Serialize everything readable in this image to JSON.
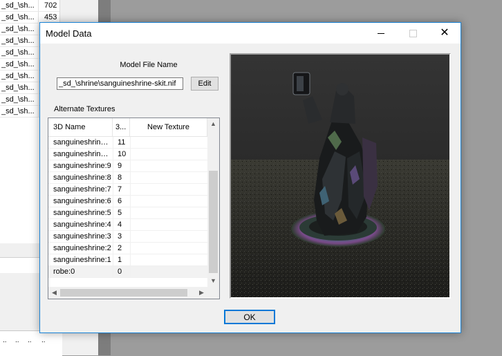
{
  "background_window": {
    "rows": [
      {
        "name": "_sd_\\sh...",
        "value": "702"
      },
      {
        "name": "_sd_\\sh...",
        "value": "453"
      },
      {
        "name": "_sd_\\sh...",
        "value": ""
      },
      {
        "name": "_sd_\\sh...",
        "value": ""
      },
      {
        "name": "_sd_\\sh...",
        "value": ""
      },
      {
        "name": "_sd_\\sh...",
        "value": ""
      },
      {
        "name": "_sd_\\sh...",
        "value": ""
      },
      {
        "name": "_sd_\\sh...",
        "value": ""
      },
      {
        "name": "_sd_\\sh...",
        "value": ""
      },
      {
        "name": "_sd_\\sh...",
        "value": ""
      }
    ],
    "bottom_cells": [
      "..",
      "..",
      "..",
      ".."
    ]
  },
  "dialog": {
    "title": "Model Data",
    "model_file_label": "Model File Name",
    "model_file_value": "_sd_\\shrine\\sanguineshrine-skit.nif",
    "edit_label": "Edit",
    "alternate_textures_label": "Alternate Textures",
    "columns": {
      "name": "3D Name",
      "index": "3...",
      "new_texture": "New Texture"
    },
    "rows": [
      {
        "name": "sanguineshrine:...",
        "index": "11",
        "new_texture": ""
      },
      {
        "name": "sanguineshrine:...",
        "index": "10",
        "new_texture": ""
      },
      {
        "name": "sanguineshrine:9",
        "index": "9",
        "new_texture": ""
      },
      {
        "name": "sanguineshrine:8",
        "index": "8",
        "new_texture": ""
      },
      {
        "name": "sanguineshrine:7",
        "index": "7",
        "new_texture": ""
      },
      {
        "name": "sanguineshrine:6",
        "index": "6",
        "new_texture": ""
      },
      {
        "name": "sanguineshrine:5",
        "index": "5",
        "new_texture": ""
      },
      {
        "name": "sanguineshrine:4",
        "index": "4",
        "new_texture": ""
      },
      {
        "name": "sanguineshrine:3",
        "index": "3",
        "new_texture": ""
      },
      {
        "name": "sanguineshrine:2",
        "index": "2",
        "new_texture": ""
      },
      {
        "name": "sanguineshrine:1",
        "index": "1",
        "new_texture": ""
      },
      {
        "name": "robe:0",
        "index": "0",
        "new_texture": ""
      }
    ],
    "ok_label": "OK",
    "colors": {
      "accent": "#0078d7",
      "border": "#1883d7"
    }
  }
}
